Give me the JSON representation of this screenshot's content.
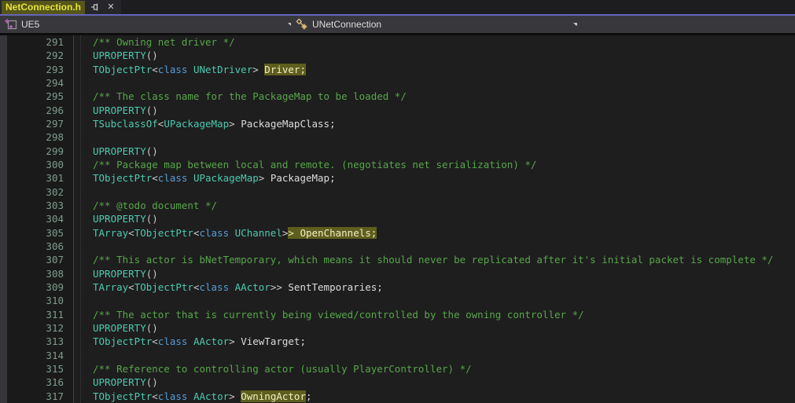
{
  "window": {
    "tab_title": "NetConnection.h"
  },
  "navbar": {
    "project_label": "UE5",
    "scope_label": "UNetConnection",
    "member_label": ""
  },
  "colors": {
    "comment": "#57A64A",
    "type": "#4EC9B0",
    "keyword": "#569CD6",
    "identifier": "#DCDCDC",
    "highlight_bg": "#5E5E1E",
    "tab_highlight_bg": "#55551C",
    "tab_title_text": "#E8E435",
    "accent_line": "#6565B8",
    "line_number": "#7E9C8D",
    "editor_bg": "#1E1E1E"
  },
  "code": {
    "first_line": 291,
    "last_line": 317,
    "lines": [
      {
        "n": 291,
        "ind": 1,
        "tok": [
          [
            "cm",
            "/** Owning net driver */"
          ]
        ]
      },
      {
        "n": 292,
        "ind": 1,
        "tok": [
          [
            "ty",
            "UPROPERTY"
          ],
          [
            "pu",
            "()"
          ]
        ]
      },
      {
        "n": 293,
        "ind": 1,
        "tok": [
          [
            "ty",
            "TObjectPtr"
          ],
          [
            "pu",
            "<"
          ],
          [
            "kw",
            "class"
          ],
          [
            "pu",
            " "
          ],
          [
            "ty",
            "UNetDriver"
          ],
          [
            "pu",
            "> "
          ],
          [
            "idh",
            "Driver;"
          ]
        ]
      },
      {
        "n": 294,
        "ind": 1,
        "tok": []
      },
      {
        "n": 295,
        "ind": 1,
        "tok": [
          [
            "cm",
            "/** The class name for the PackageMap to be loaded */"
          ]
        ]
      },
      {
        "n": 296,
        "ind": 1,
        "tok": [
          [
            "ty",
            "UPROPERTY"
          ],
          [
            "pu",
            "()"
          ]
        ]
      },
      {
        "n": 297,
        "ind": 1,
        "tok": [
          [
            "ty",
            "TSubclassOf"
          ],
          [
            "pu",
            "<"
          ],
          [
            "ty",
            "UPackageMap"
          ],
          [
            "pu",
            "> "
          ],
          [
            "id",
            "PackageMapClass;"
          ]
        ]
      },
      {
        "n": 298,
        "ind": 1,
        "tok": []
      },
      {
        "n": 299,
        "ind": 1,
        "tok": [
          [
            "ty",
            "UPROPERTY"
          ],
          [
            "pu",
            "()"
          ]
        ]
      },
      {
        "n": 300,
        "ind": 1,
        "tok": [
          [
            "cm",
            "/** Package map between local and remote. (negotiates net serialization) */"
          ]
        ]
      },
      {
        "n": 301,
        "ind": 1,
        "tok": [
          [
            "ty",
            "TObjectPtr"
          ],
          [
            "pu",
            "<"
          ],
          [
            "kw",
            "class"
          ],
          [
            "pu",
            " "
          ],
          [
            "ty",
            "UPackageMap"
          ],
          [
            "pu",
            "> "
          ],
          [
            "id",
            "PackageMap;"
          ]
        ]
      },
      {
        "n": 302,
        "ind": 1,
        "tok": []
      },
      {
        "n": 303,
        "ind": 1,
        "tok": [
          [
            "cm",
            "/** @todo document */"
          ]
        ]
      },
      {
        "n": 304,
        "ind": 1,
        "tok": [
          [
            "ty",
            "UPROPERTY"
          ],
          [
            "pu",
            "()"
          ]
        ]
      },
      {
        "n": 305,
        "ind": 1,
        "tok": [
          [
            "ty",
            "TArray"
          ],
          [
            "pu",
            "<"
          ],
          [
            "ty",
            "TObjectPtr"
          ],
          [
            "pu",
            "<"
          ],
          [
            "kw",
            "class"
          ],
          [
            "pu",
            " "
          ],
          [
            "ty",
            "UChannel"
          ],
          [
            "pu",
            ">"
          ],
          [
            "puh",
            "> "
          ],
          [
            "idh",
            "OpenChannels;"
          ]
        ]
      },
      {
        "n": 306,
        "ind": 1,
        "tok": []
      },
      {
        "n": 307,
        "ind": 1,
        "tok": [
          [
            "cm",
            "/** This actor is bNetTemporary, which means it should never be replicated after it's initial packet is complete */"
          ]
        ]
      },
      {
        "n": 308,
        "ind": 1,
        "tok": [
          [
            "ty",
            "UPROPERTY"
          ],
          [
            "pu",
            "()"
          ]
        ]
      },
      {
        "n": 309,
        "ind": 1,
        "tok": [
          [
            "ty",
            "TArray"
          ],
          [
            "pu",
            "<"
          ],
          [
            "ty",
            "TObjectPtr"
          ],
          [
            "pu",
            "<"
          ],
          [
            "kw",
            "class"
          ],
          [
            "pu",
            " "
          ],
          [
            "ty",
            "AActor"
          ],
          [
            "pu",
            ">> "
          ],
          [
            "id",
            "SentTemporaries;"
          ]
        ]
      },
      {
        "n": 310,
        "ind": 1,
        "tok": []
      },
      {
        "n": 311,
        "ind": 1,
        "tok": [
          [
            "cm",
            "/** The actor that is currently being viewed/controlled by the owning controller */"
          ]
        ]
      },
      {
        "n": 312,
        "ind": 1,
        "tok": [
          [
            "ty",
            "UPROPERTY"
          ],
          [
            "pu",
            "()"
          ]
        ]
      },
      {
        "n": 313,
        "ind": 1,
        "tok": [
          [
            "ty",
            "TObjectPtr"
          ],
          [
            "pu",
            "<"
          ],
          [
            "kw",
            "class"
          ],
          [
            "pu",
            " "
          ],
          [
            "ty",
            "AActor"
          ],
          [
            "pu",
            "> "
          ],
          [
            "id",
            "ViewTarget;"
          ]
        ]
      },
      {
        "n": 314,
        "ind": 1,
        "tok": []
      },
      {
        "n": 315,
        "ind": 1,
        "tok": [
          [
            "cm",
            "/** Reference to controlling actor (usually PlayerController) */"
          ]
        ]
      },
      {
        "n": 316,
        "ind": 1,
        "tok": [
          [
            "ty",
            "UPROPERTY"
          ],
          [
            "pu",
            "()"
          ]
        ]
      },
      {
        "n": 317,
        "ind": 1,
        "tok": [
          [
            "ty",
            "TObjectPtr"
          ],
          [
            "pu",
            "<"
          ],
          [
            "kw",
            "class"
          ],
          [
            "pu",
            " "
          ],
          [
            "ty",
            "AActor"
          ],
          [
            "pu",
            "> "
          ],
          [
            "idh",
            "OwningActor"
          ],
          [
            "id",
            ";"
          ]
        ]
      }
    ]
  }
}
